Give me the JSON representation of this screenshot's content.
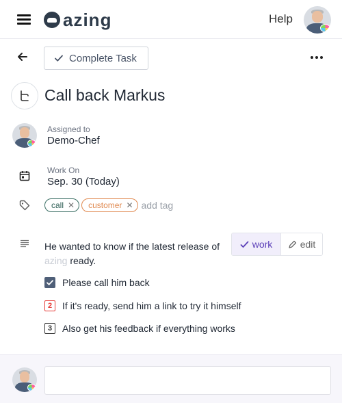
{
  "header": {
    "logo_text": "azing",
    "help_label": "Help",
    "brand_color": "#2e3b4a"
  },
  "toolbar": {
    "complete_label": "Complete Task",
    "back_icon": "arrow-left-icon",
    "more_icon": "more-horizontal-icon"
  },
  "task": {
    "title": "Call back Markus",
    "type_icon": "workflow-branch-icon",
    "assigned_label": "Assigned to",
    "assigned_value": "Demo-Chef",
    "work_on_label": "Work On",
    "work_on_value": "Sep. 30 (Today)",
    "tags": [
      {
        "label": "call",
        "color": "#3a6f64"
      },
      {
        "label": "customer",
        "color": "#e0894f"
      }
    ],
    "add_tag_placeholder": "add tag",
    "description_main": "He wanted to know if the latest release of",
    "description_faded": "azing",
    "description_end": "ready.",
    "view_toggle": {
      "work_label": "work",
      "edit_label": "edit",
      "active": "work",
      "accent": "#5b3fb8"
    },
    "checklist": [
      {
        "marker": "",
        "state": "checked",
        "text": "Please call him back"
      },
      {
        "marker": "2",
        "state": "pending-red",
        "text": "If it's ready, send him a link to try it himself"
      },
      {
        "marker": "3",
        "state": "pending",
        "text": "Also get his feedback if everything works"
      }
    ]
  },
  "comment": {
    "placeholder": ""
  }
}
